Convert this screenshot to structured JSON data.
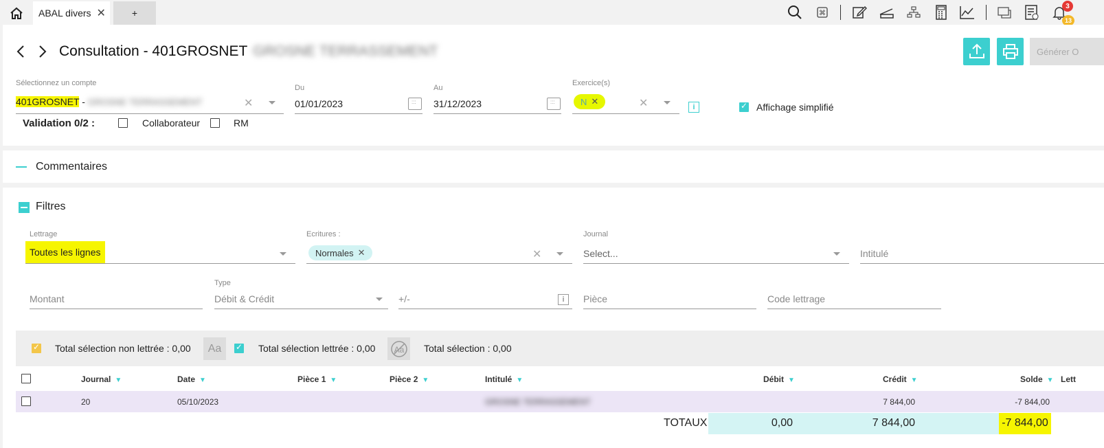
{
  "tabs": {
    "active_label": "ABAL divers",
    "add_label": "+"
  },
  "toolbar": {
    "icons": [
      "search-icon",
      "shortcut-icon",
      "edit-icon",
      "scanner-icon",
      "org-chart-icon",
      "calculator-icon",
      "chart-icon",
      "chat-icon",
      "checklist-icon",
      "bell-icon"
    ],
    "badge_red": "3",
    "badge_yellow": "13"
  },
  "header": {
    "title": "Consultation - 401GROSNET",
    "title_blurred": "GROSNE TERRASSEMENT",
    "generate_label": "Générer O"
  },
  "account": {
    "label": "Sélectionnez un compte",
    "code": "401GROSNET",
    "sep": " - ",
    "name_blurred": "GROSNE TERRASSEMENT"
  },
  "dates": {
    "from_label": "Du",
    "from_value": "01/01/2023",
    "to_label": "Au",
    "to_value": "31/12/2023"
  },
  "exercise": {
    "label": "Exercice(s)",
    "chip": "N"
  },
  "simplified": {
    "label": "Affichage simplifié",
    "checked": true
  },
  "validation": {
    "label": "Validation 0/2 :",
    "collab": "Collaborateur",
    "rm": "RM"
  },
  "comments": {
    "title": "Commentaires"
  },
  "filters": {
    "title": "Filtres",
    "lettrage_label": "Lettrage",
    "lettrage_value": "Toutes les lignes",
    "ecritures_label": "Ecritures :",
    "ecritures_chip": "Normales",
    "journal_label": "Journal",
    "journal_placeholder": "Select...",
    "intitule_placeholder": "Intitulé",
    "montant_placeholder": "Montant",
    "type_label": "Type",
    "type_value": "Débit & Crédit",
    "plusminus_placeholder": "+/-",
    "piece_placeholder": "Pièce",
    "code_lettrage_placeholder": "Code lettrage"
  },
  "summary": {
    "non_lettree": "Total sélection non lettrée : 0,00",
    "lettree": "Total sélection lettrée : 0,00",
    "total": "Total sélection : 0,00",
    "aa": "Aa"
  },
  "table": {
    "columns": [
      "Journal",
      "Date",
      "Pièce 1",
      "Pièce 2",
      "Intitulé",
      "Débit",
      "Crédit",
      "Solde",
      "Lett"
    ],
    "rows": [
      {
        "journal": "20",
        "date": "05/10/2023",
        "piece1": "",
        "piece2": "",
        "intitule_blurred": "GROSNE TERRASSEMENT",
        "debit": "",
        "credit": "7 844,00",
        "solde": "-7 844,00"
      }
    ],
    "totals": {
      "label": "TOTAUX",
      "debit": "0,00",
      "credit": "7 844,00",
      "solde": "-7 844,00"
    }
  }
}
